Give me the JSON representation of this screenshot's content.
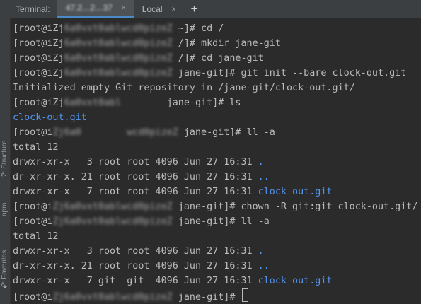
{
  "tabbar": {
    "label": "Terminal:",
    "tabs": [
      {
        "title": "47.2․․.2․․.37",
        "close": "×",
        "active": true
      },
      {
        "title": "Local",
        "close": "×",
        "active": false
      }
    ],
    "add_icon": "+"
  },
  "toolstrip": {
    "structure": "2: Structure",
    "npm": "npm",
    "favorites": "2: Favorites",
    "star_icon": "star-icon"
  },
  "terminal": {
    "lines": [
      {
        "pre": "[root@iZj",
        "blur": "6a0vxt0ablwcd0pizeZ",
        "post": " ~]# cd /"
      },
      {
        "pre": "[root@iZj",
        "blur": "6a0vxt0ablwcd0pizeZ",
        "post": " /]# mkdir jane-git"
      },
      {
        "pre": "[root@iZj",
        "blur": "6a0vxt0ablwcd0pizeZ",
        "post": " /]# cd jane-git"
      },
      {
        "pre": "[root@iZj",
        "blur": "6a0vxt0ablwcd0pizeZ",
        "post": " jane-git]# git init --bare clock-out.git"
      },
      {
        "text": "Initialized empty Git repository in /jane-git/clock-out.git/"
      },
      {
        "pre": "[root@iZj",
        "blur": "6a0vxt0abl       ",
        "post": " jane-git]# ls"
      },
      {
        "text": "clock-out.git",
        "blue": true
      },
      {
        "pre": "[root@i",
        "blur": "Zj6a0        wcd0pizeZ",
        "post": " jane-git]# ll -a"
      },
      {
        "text": "total 12"
      },
      {
        "text": "drwxr-xr-x   3 root root 4096 Jun 27 16:31 ",
        "tail": ".",
        "tail_blue": true
      },
      {
        "text": "dr-xr-xr-x. 21 root root 4096 Jun 27 16:31 ",
        "tail": "..",
        "tail_blue": true
      },
      {
        "text": "drwxr-xr-x   7 root root 4096 Jun 27 16:31 ",
        "tail": "clock-out.git",
        "tail_blue": true
      },
      {
        "pre": "[root@i",
        "blur": "Zj6a0vxt0ablwcd0pizeZ",
        "post": " jane-git]# chown -R git:git clock-out.git/"
      },
      {
        "pre": "[root@i",
        "blur": "Zj6a0vxt0ablwcd0pizeZ",
        "post": " jane-git]# ll -a"
      },
      {
        "text": "total 12"
      },
      {
        "text": "drwxr-xr-x   3 root root 4096 Jun 27 16:31 ",
        "tail": ".",
        "tail_blue": true
      },
      {
        "text": "dr-xr-xr-x. 21 root root 4096 Jun 27 16:31 ",
        "tail": "..",
        "tail_blue": true
      },
      {
        "text": "drwxr-xr-x   7 git  git  4096 Jun 27 16:31 ",
        "tail": "clock-out.git",
        "tail_blue": true
      },
      {
        "pre": "[root@i",
        "blur": "Zj6a0vxt0ablwcd0pizeZ",
        "post": " jane-git]# ",
        "cursor": true
      }
    ]
  },
  "colors": {
    "background": "#2b2b2b",
    "text": "#bbbbbb",
    "directory_blue": "#5394ec",
    "active_tab_underline": "#4a88c7"
  }
}
